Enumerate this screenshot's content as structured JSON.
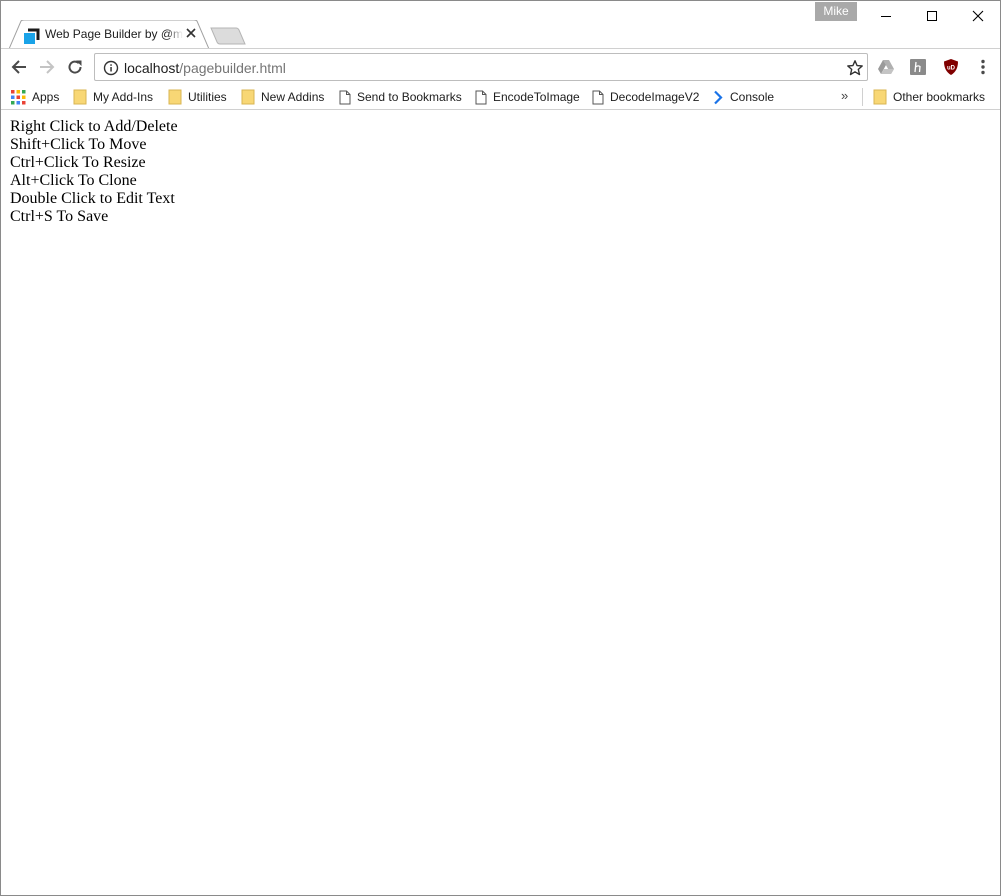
{
  "browser": {
    "profile_name": "Mike",
    "tab": {
      "title": "Web Page Builder by @mikeal",
      "favicon": "page-builder-favicon"
    },
    "address_bar": {
      "host": "localhost",
      "path": "/pagebuilder.html"
    },
    "bookmarks": [
      {
        "label": "Apps",
        "icon": "apps-grid-icon"
      },
      {
        "label": "My Add-Ins",
        "icon": "folder-icon"
      },
      {
        "label": "Utilities",
        "icon": "folder-icon"
      },
      {
        "label": "New Addins",
        "icon": "folder-icon"
      },
      {
        "label": "Send to Bookmarks",
        "icon": "page-icon"
      },
      {
        "label": "EncodeToImage",
        "icon": "page-icon"
      },
      {
        "label": "DecodeImageV2",
        "icon": "page-icon"
      },
      {
        "label": "Console",
        "icon": "chevron-right-icon"
      }
    ],
    "bookmarks_overflow": "»",
    "other_bookmarks": "Other bookmarks",
    "colors": {
      "folder": "#f8d775",
      "profile_bg": "#a9a9a9",
      "ublock": "#800000",
      "favicon_blue": "#1aa3e8"
    }
  },
  "page": {
    "instructions": [
      "Right Click to Add/Delete",
      "Shift+Click To Move",
      "Ctrl+Click To Resize",
      "Alt+Click To Clone",
      "Double Click to Edit Text",
      "Ctrl+S To Save"
    ]
  }
}
